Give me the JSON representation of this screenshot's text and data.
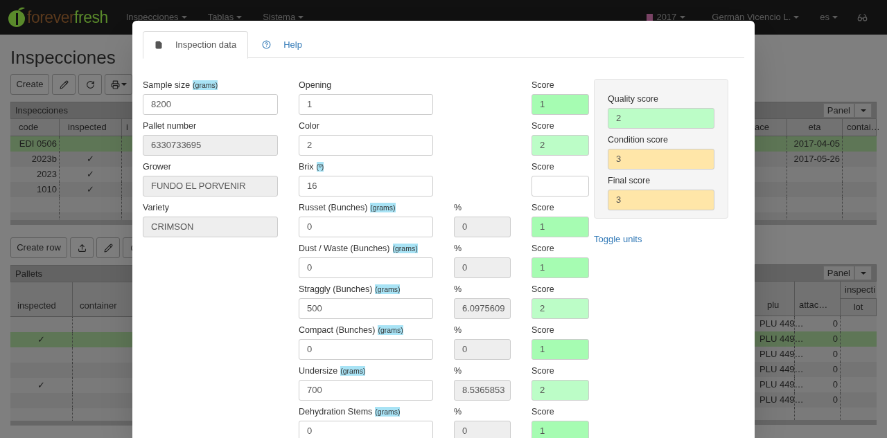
{
  "navbar": {
    "logo": {
      "part1": "forever",
      "part2": "fresh"
    },
    "menus": [
      {
        "label": "Inspecciones"
      },
      {
        "label": "Tablas"
      },
      {
        "label": "Sistema"
      }
    ],
    "season": "2017",
    "user": "Germán Vicencio L.",
    "language": "es"
  },
  "page_title": "Inspecciones",
  "toolbar": {
    "create": "Create"
  },
  "inspections_panel": {
    "title": "Inspecciones",
    "panel_button": "Panel",
    "columns_left": [
      "code",
      "inspected",
      "i"
    ],
    "columns_right": [
      "ace",
      "eta",
      "contai…"
    ],
    "rows": [
      {
        "code": "EDI 0506",
        "eta": "2017-04-05",
        "selected": true
      },
      {
        "code": "2023b",
        "inspected": "✓",
        "eta": "2017-05-26",
        "selected": false
      },
      {
        "code": "2023",
        "inspected": "✓",
        "selected": false
      },
      {
        "code": "1010",
        "inspected": "✓",
        "selected": false
      },
      {
        "selected": false
      },
      {
        "selected": false
      }
    ]
  },
  "pallets_toolbar": {
    "create": "Create row"
  },
  "pallets_panel": {
    "title": "Pallets",
    "panel_button": "Panel",
    "columns_left": [
      "inspected",
      "container"
    ],
    "columns_right": [
      "plu",
      "attac…"
    ],
    "group_header": "inspecti",
    "group_columns": [
      "lot"
    ],
    "rows": [
      {
        "plu": "PLU 449…",
        "attac": "0",
        "selected": false
      },
      {
        "inspected": "✓",
        "plu": "PLU 449…",
        "attac": "0",
        "selected": true
      },
      {
        "plu": "PLU 449…",
        "attac": "0",
        "selected": false
      },
      {
        "plu": "PLU 449…",
        "attac": "0",
        "selected": false
      },
      {
        "inspected": "✓",
        "plu": "PLU 449…",
        "attac": "0",
        "selected": false
      },
      {
        "plu": "PLU 449…",
        "attac": "0",
        "selected": false
      },
      {
        "selected": false
      }
    ]
  },
  "modal": {
    "tabs": [
      {
        "label": "Inspection data",
        "selected": true
      },
      {
        "label": "Help",
        "selected": false
      }
    ],
    "general_fields": [
      {
        "label": "Sample size",
        "unit": "(grams)",
        "value": "8200",
        "readonly": false
      },
      {
        "label": "Pallet number",
        "value": "6330733695",
        "readonly": true
      },
      {
        "label": "Grower",
        "value": "FUNDO EL PORVENIR",
        "readonly": true
      },
      {
        "label": "Variety",
        "value": "CRIMSON",
        "readonly": true
      }
    ],
    "criteria": [
      {
        "label": "Opening",
        "value": "1",
        "score": {
          "label": "Score",
          "value": "1",
          "color": "#a6fcb2"
        }
      },
      {
        "label": "Color",
        "value": "2",
        "score": {
          "label": "Score",
          "value": "2",
          "color": "#bcfdc7"
        }
      },
      {
        "label": "Brix",
        "unit": "(º)",
        "value": "16",
        "score": {
          "label": "Score"
        }
      },
      {
        "label": "Russet (Bunches)",
        "unit": "(grams)",
        "value": "0",
        "percent": {
          "label": "%",
          "value": "0"
        },
        "score": {
          "label": "Score",
          "value": "1",
          "color": "#a6fcb2"
        }
      },
      {
        "label": "Dust / Waste (Bunches)",
        "unit": "(grams)",
        "value": "0",
        "percent": {
          "label": "%",
          "value": "0"
        },
        "score": {
          "label": "Score",
          "value": "1",
          "color": "#a6fcb2"
        }
      },
      {
        "label": "Straggly (Bunches)",
        "unit": "(grams)",
        "value": "500",
        "percent": {
          "label": "%",
          "value": "6.0975609"
        },
        "score": {
          "label": "Score",
          "value": "2",
          "color": "#bcfdc7"
        }
      },
      {
        "label": "Compact (Bunches)",
        "unit": "(grams)",
        "value": "0",
        "percent": {
          "label": "%",
          "value": "0"
        },
        "score": {
          "label": "Score",
          "value": "1",
          "color": "#a6fcb2"
        }
      },
      {
        "label": "Undersize",
        "unit": "(grams)",
        "value": "700",
        "percent": {
          "label": "%",
          "value": "8.5365853"
        },
        "score": {
          "label": "Score",
          "value": "2",
          "color": "#bcfdc7"
        }
      },
      {
        "label": "Dehydration Stems",
        "unit": "(grams)",
        "value": "0",
        "percent": {
          "label": "%",
          "value": "0"
        },
        "score": {
          "label": "Score",
          "value": "1",
          "color": "#a6fcb2"
        }
      }
    ],
    "summary": [
      {
        "label": "Quality score",
        "value": "2",
        "color": "#bcfdc7"
      },
      {
        "label": "Condition score",
        "value": "3",
        "color": "#ffe6a8"
      },
      {
        "label": "Final score",
        "value": "3",
        "color": "#ffe6a8"
      }
    ],
    "toggle_link": "Toggle units"
  }
}
